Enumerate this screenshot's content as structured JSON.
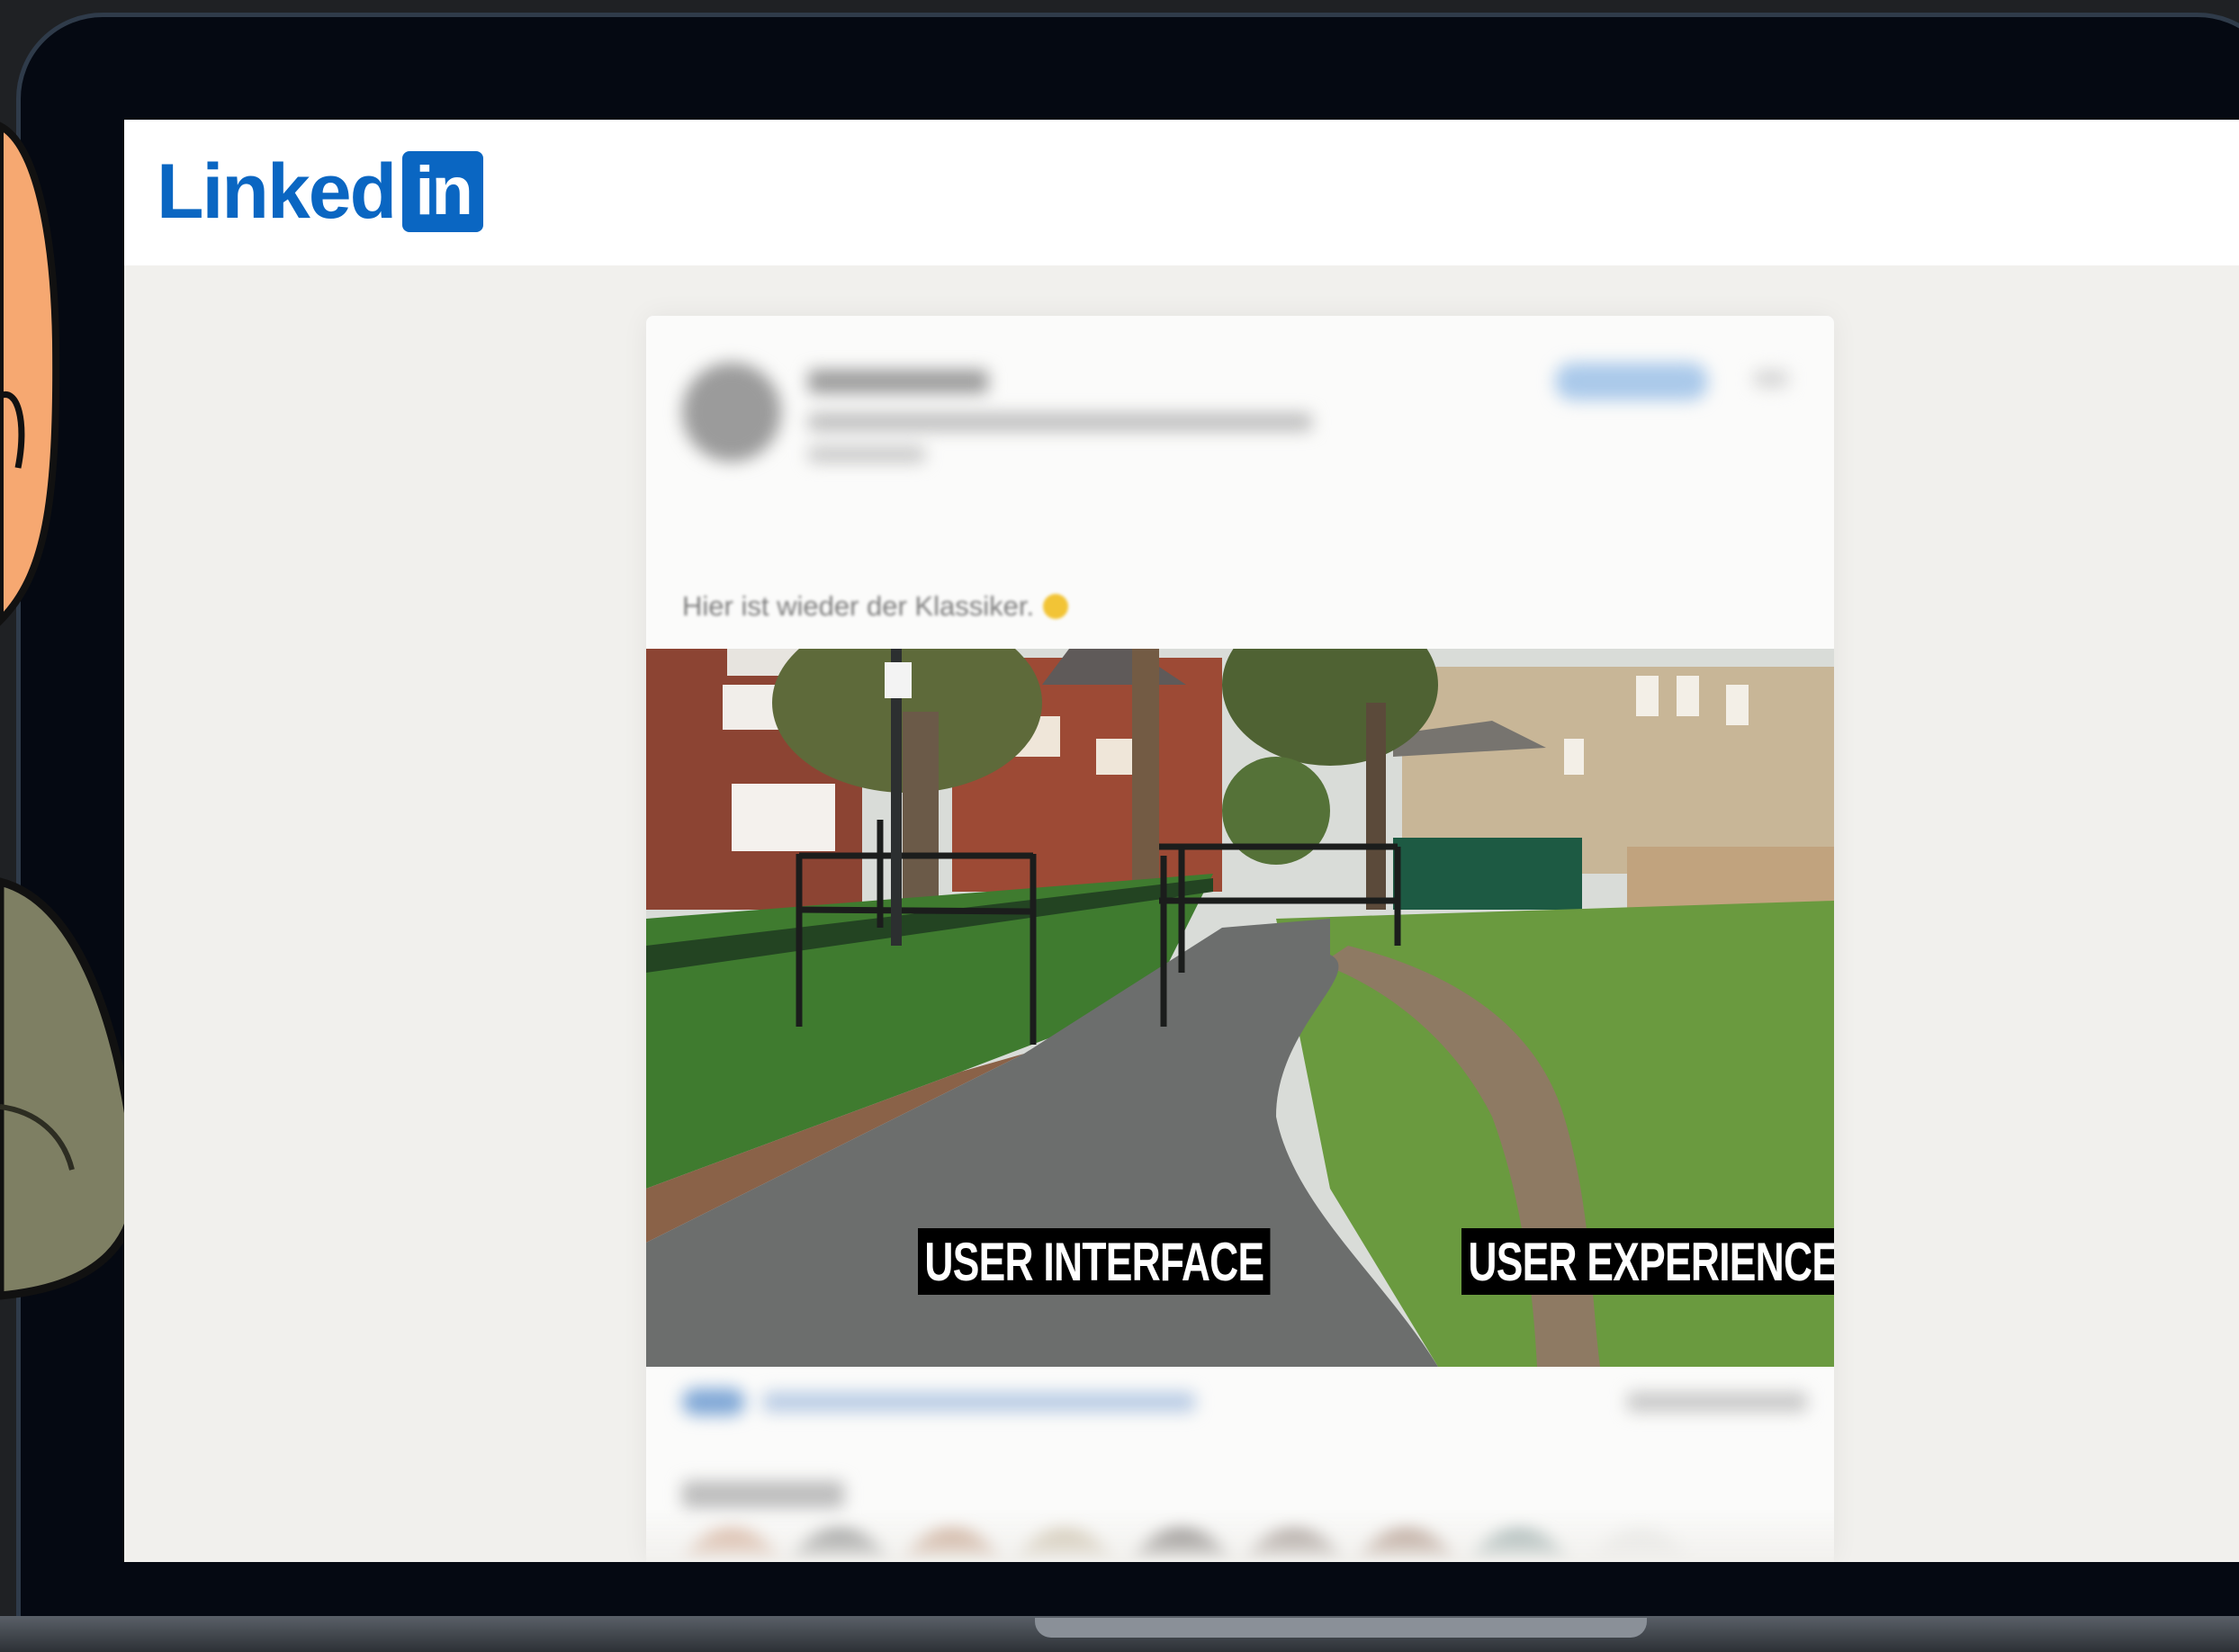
{
  "header": {
    "logo_text": "Linked",
    "logo_box_text": "in",
    "brand_color": "#0a66c2"
  },
  "post": {
    "caption": "Hier ist wieder der Klassiker.",
    "image": {
      "label_left": "USER INTERFACE",
      "label_right": "USER EXPERIENCE"
    }
  },
  "icons": [
    "linkedin-logo",
    "emoji-icon",
    "reaction-icons"
  ]
}
